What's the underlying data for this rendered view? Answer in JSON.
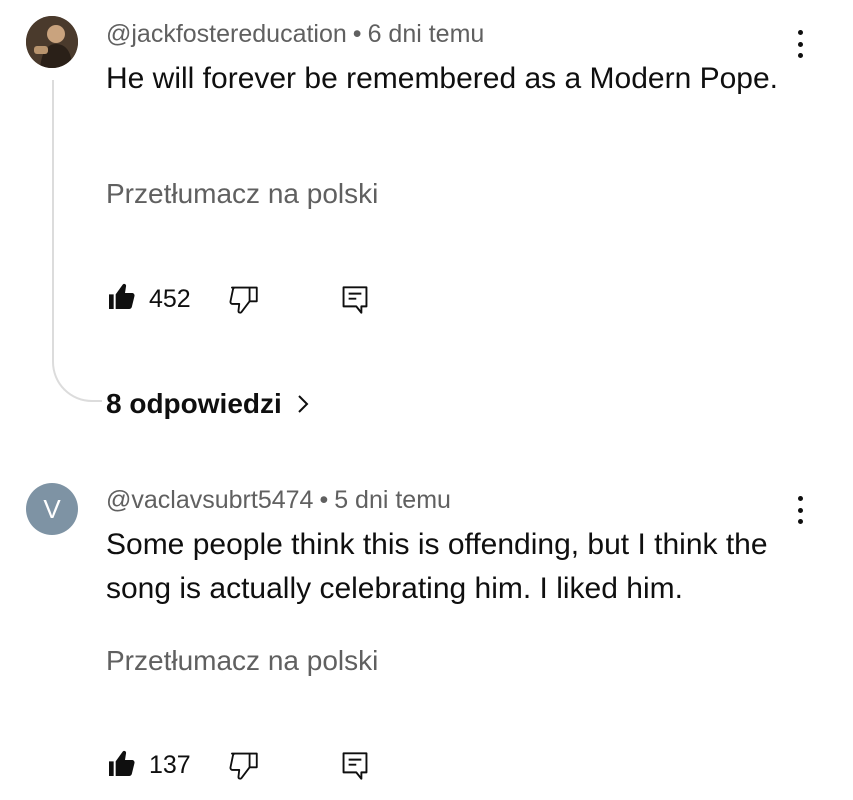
{
  "comments": [
    {
      "handle": "@jackfostereducation",
      "separator": "•",
      "time": "6 dni temu",
      "text": "He will forever be remembered as a Modern Pope.",
      "translate_label": "Przetłumacz na polski",
      "likes": "452",
      "replies_label": "8 odpowiedzi"
    },
    {
      "avatar_letter": "V",
      "handle": "@vaclavsubrt5474",
      "separator": "•",
      "time": "5 dni temu",
      "text": "Some people think this is offending, but I think the song is actually celebrating him. I liked him.",
      "translate_label": "Przetłumacz na polski",
      "likes": "137"
    }
  ],
  "icons": {
    "like": "thumbs-up-filled-icon",
    "dislike": "thumbs-down-outline-icon",
    "reply": "reply-comment-icon",
    "menu": "more-vertical-icon",
    "chevron": "chevron-right-icon"
  },
  "colors": {
    "avatar_v": "#7e93a4",
    "secondary_text": "#606060",
    "thread_line": "#dcdcdc"
  }
}
